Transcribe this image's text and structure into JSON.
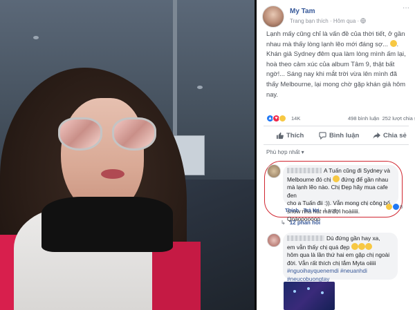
{
  "post": {
    "author": "My Tam",
    "meta": "Trang bạn thích · Hôm qua · ",
    "text": "Lạnh mấy cũng chỉ là vấn đề của thời tiết, ở gần nhau mà thấy lòng lạnh lẽo mới đáng sợ... ",
    "text2": ". Khán giả Sydney đêm qua làm lòng mình ấm lại, hoà theo cảm xúc của album Tâm 9, thật bất ngờ!... Sáng nay khi mắt trời vừa lên mình đã thấy Melbourne, lại mong chờ gặp khán giả hôm nay."
  },
  "reactions": {
    "count": "14K",
    "comments": "498 bình luận",
    "shares": "252 lượt chia sẻ",
    "icons": [
      "like",
      "love",
      "haha"
    ]
  },
  "actions": {
    "like_label": "Thích",
    "comment_label": "Bình luận",
    "share_label": "Chia sẻ"
  },
  "sort_label": "Phù hợp nhất ▾",
  "comment1": {
    "line1": "A Tuấn cũng đi Sydney và",
    "line2": "Melbourne đó chị",
    "line2b": " đứng để gần nhau",
    "line3": "mà lạnh lẽo nào. Chị Đẹp hãy mua cafe đen",
    "line4": "cho a Tuấn đii :)). Vẫn mong chị công bố",
    "line5": "show nhà hát mà đợi hoàiiiii. Qoàooooooo",
    "like": "Thích",
    "reply": "Trả lời",
    "time": "1 ngày",
    "reaction_count": "8"
  },
  "replies_label": "12 phản hồi",
  "comment2": {
    "line1": "Dù đứng gần hay xa,",
    "line2": "em vẫn thấy chị quá đẹp",
    "line3": "hôm qua là lần thứ hai em gặp chị ngoài",
    "line4": "đời. Vẫn rất thích chị lắm Myta oiiiii",
    "tag1": "#nguoihayquenemdi #neuanhdi",
    "tag2": "#neucobuongtay"
  },
  "colors": {
    "link": "#365899",
    "highlight": "#d0252f",
    "like_blue": "#2078f4",
    "love_red": "#f0284a",
    "haha_yellow": "#f7c843"
  },
  "icons": {
    "like": "thumbs-up-icon",
    "comment": "speech-bubble-icon",
    "share": "share-arrow-icon",
    "globe": "globe-icon",
    "more": "ellipsis-icon"
  }
}
